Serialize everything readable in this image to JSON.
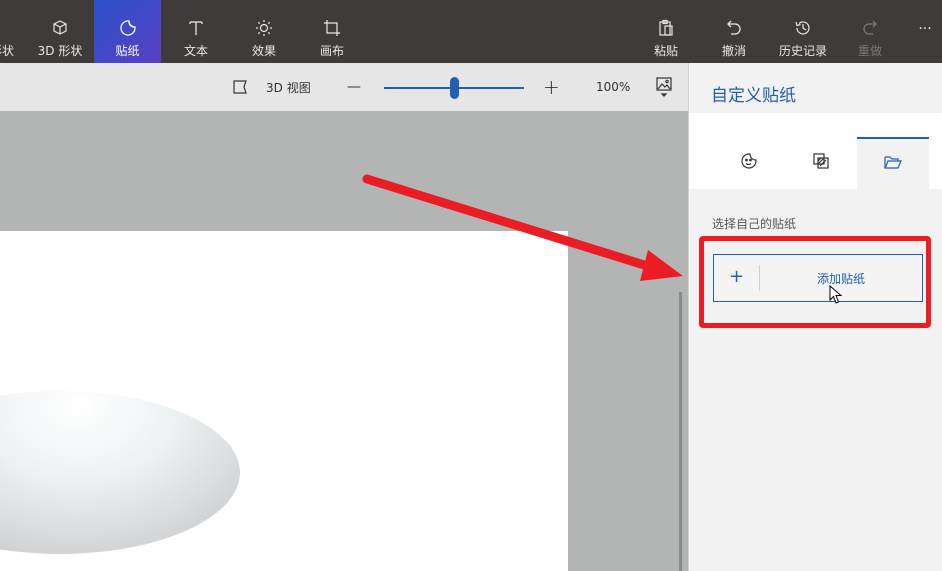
{
  "toolbar": {
    "shapes_partial": "形状",
    "shapes3d": "3D 形状",
    "stickers": "贴纸",
    "text": "文本",
    "effects": "效果",
    "canvas": "画布",
    "paste": "粘贴",
    "undo": "撤消",
    "history": "历史记录",
    "redo": "重做",
    "more": "···"
  },
  "viewbar": {
    "view3d": "3D 视图",
    "zoom_minus": "—",
    "zoom_plus": "+",
    "zoom_level": "100%",
    "zoom_fraction": 0.5
  },
  "panel": {
    "title": "自定义贴纸",
    "section_label": "选择自己的贴纸",
    "add_plus": "+",
    "add_label": "添加贴纸"
  },
  "colors": {
    "accent": "#1f5fb5",
    "annotation": "#ea1c24",
    "toolbar_bg": "#3e3b3a"
  }
}
